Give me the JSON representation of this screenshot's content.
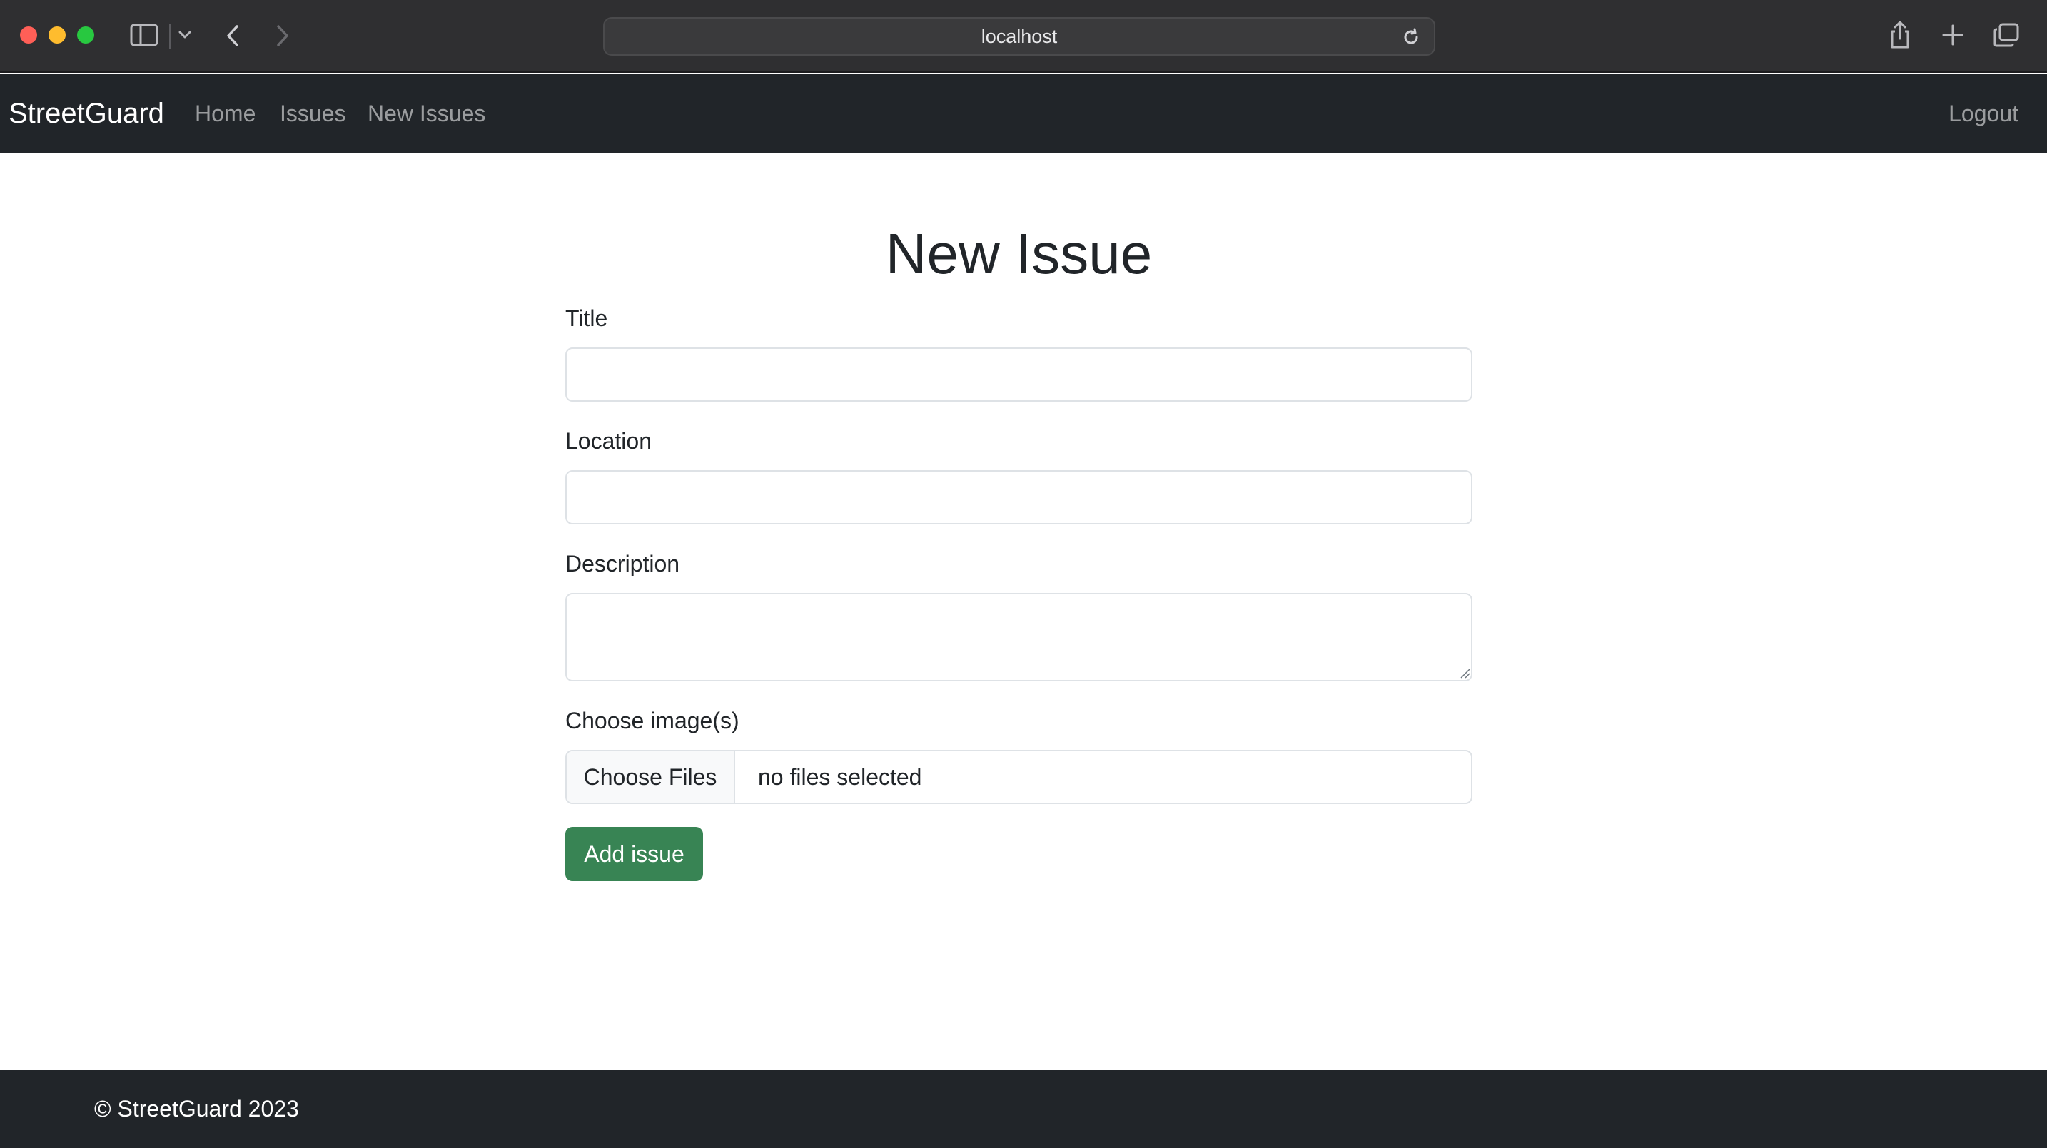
{
  "browser": {
    "url": "localhost",
    "icons": [
      "sidebar-icon",
      "chevron-down-icon",
      "back-icon",
      "forward-icon",
      "reload-icon",
      "share-icon",
      "new-tab-icon",
      "tabs-overview-icon"
    ]
  },
  "navbar": {
    "brand": "StreetGuard",
    "links": [
      {
        "label": "Home"
      },
      {
        "label": "Issues"
      },
      {
        "label": "New Issues"
      }
    ],
    "logout": "Logout"
  },
  "form": {
    "heading": "New Issue",
    "title_label": "Title",
    "title_value": "",
    "location_label": "Location",
    "location_value": "",
    "description_label": "Description",
    "description_value": "",
    "images_label": "Choose image(s)",
    "choose_files_label": "Choose Files",
    "files_status": "no files selected",
    "submit_label": "Add issue"
  },
  "footer": {
    "text": "© StreetGuard 2023"
  },
  "colors": {
    "navbar_bg": "#212529",
    "submit_bg": "#388454",
    "chrome_bg": "#2f2f31"
  }
}
